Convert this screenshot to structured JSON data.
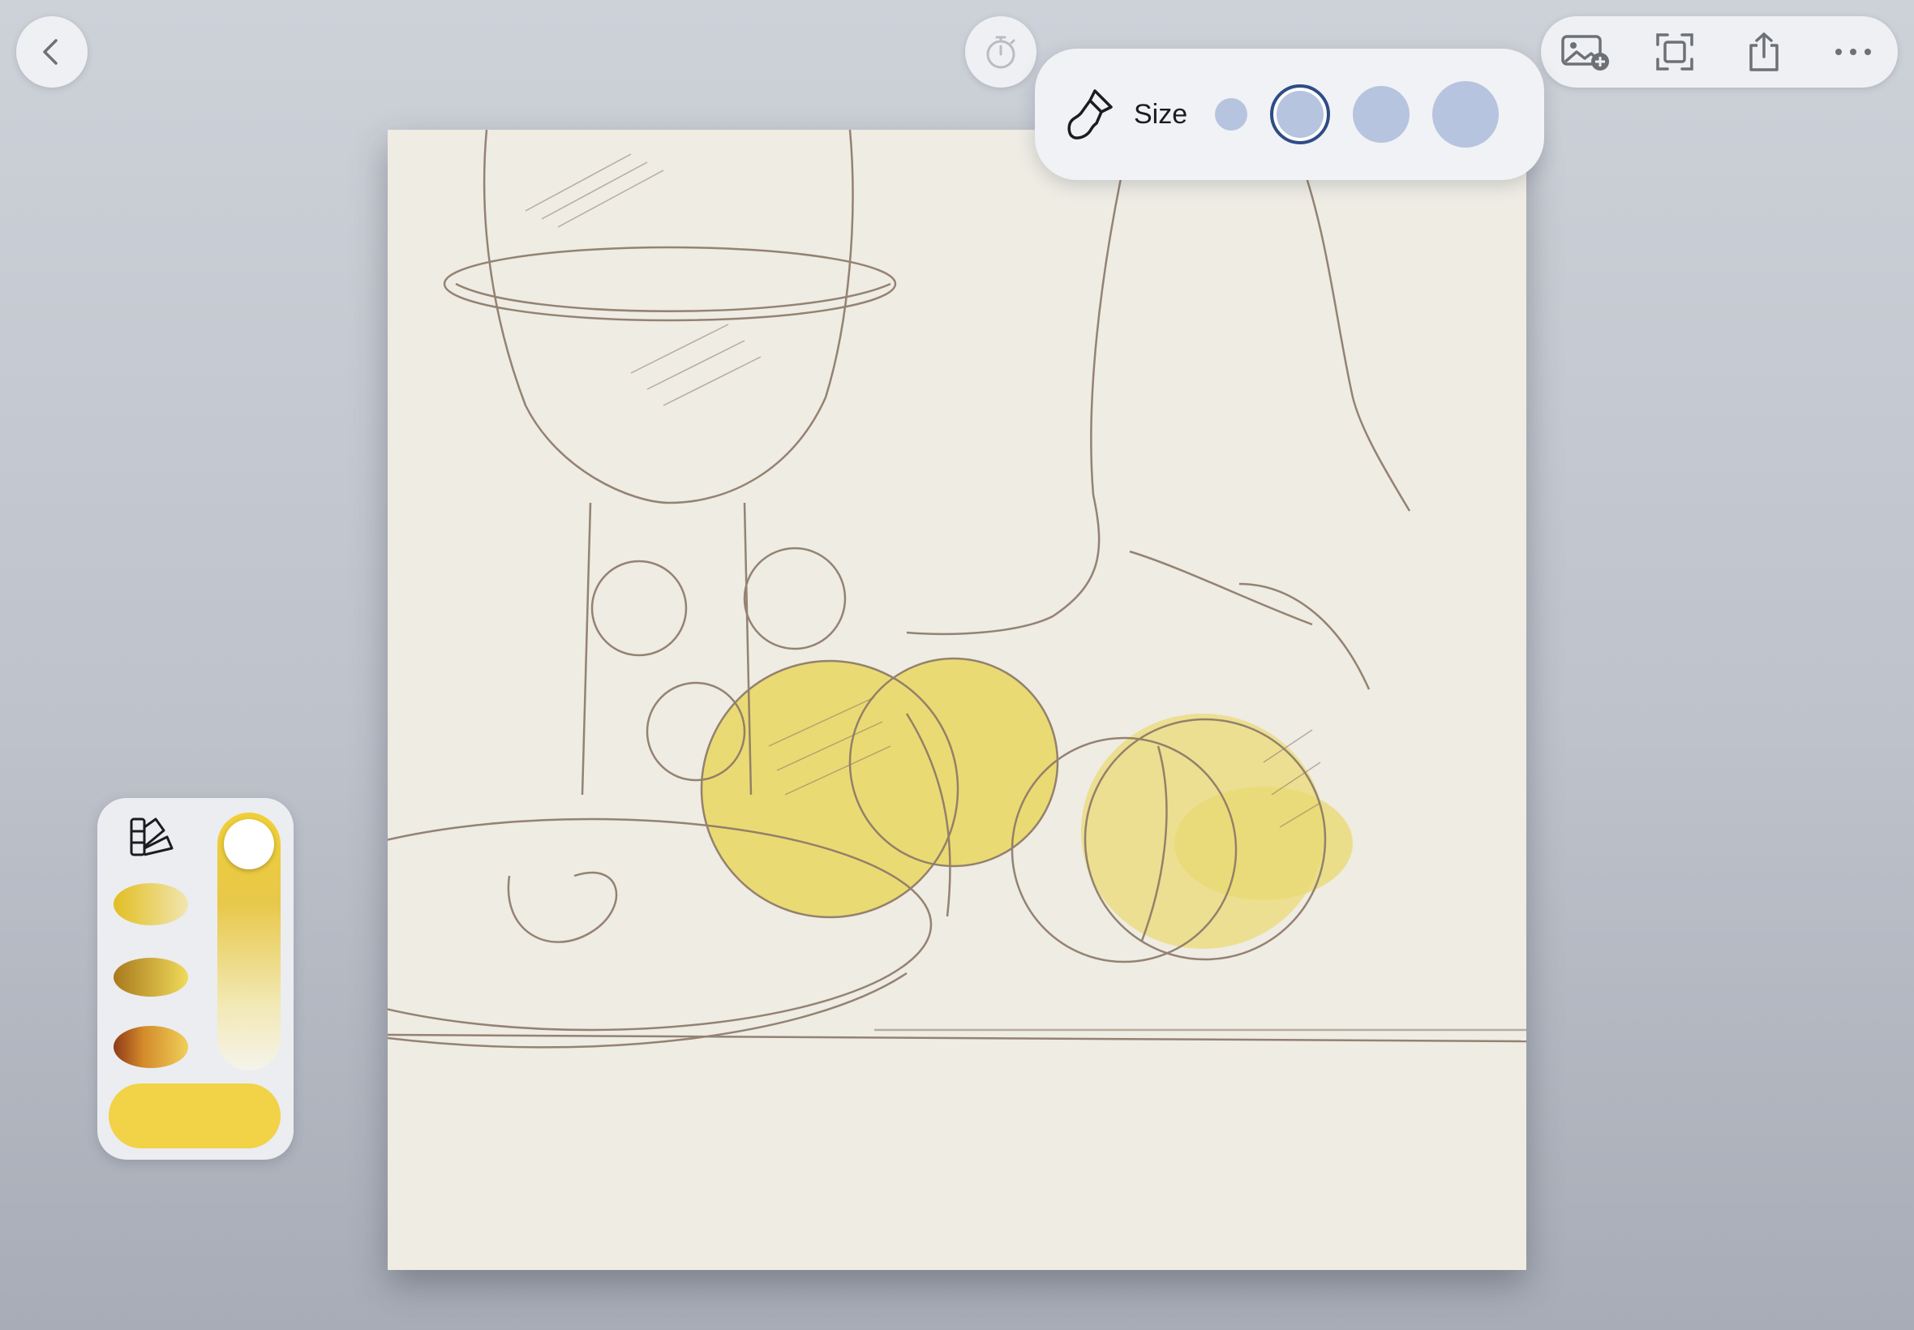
{
  "top_bar": {
    "back_icon": "chevron-left-icon",
    "timer_icon": "stopwatch-icon",
    "actions": [
      {
        "icon": "add-image-icon"
      },
      {
        "icon": "fullscreen-icon"
      },
      {
        "icon": "share-icon"
      },
      {
        "icon": "more-icon"
      }
    ]
  },
  "brush_popover": {
    "tool_icon": "paintbrush-icon",
    "size_label": "Size",
    "sizes": [
      {
        "level": 1,
        "selected": false
      },
      {
        "level": 2,
        "selected": true
      },
      {
        "level": 3,
        "selected": false
      },
      {
        "level": 4,
        "selected": false
      }
    ],
    "size_color": "#b7c4df",
    "selected_ring_color": "#2f4c86"
  },
  "canvas": {
    "paper_color": "#eeece3",
    "sketch_color": "#8a7767",
    "paint_color": "#e9d760"
  },
  "palette": {
    "swatch_book_icon": "color-swatches-icon",
    "recent_swatches": [
      {
        "colors": [
          "#e2be22",
          "#f1e6b0"
        ]
      },
      {
        "colors": [
          "#a8791d",
          "#f0da5a"
        ]
      },
      {
        "colors": [
          "#8e3a18",
          "#f0cf5a"
        ]
      }
    ],
    "opacity_level": 1.0,
    "current_color": "#f2d246"
  }
}
